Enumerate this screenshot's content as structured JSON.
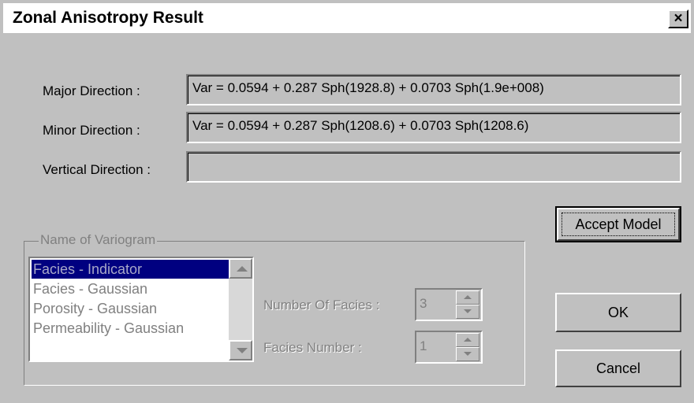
{
  "window": {
    "title": "Zonal Anisotropy Result",
    "close_symbol": "×"
  },
  "directions": [
    {
      "label": "Major Direction :",
      "value": "Var = 0.0594 + 0.287 Sph(1928.8) + 0.0703 Sph(1.9e+008)"
    },
    {
      "label": "Minor Direction :",
      "value": "Var = 0.0594 + 0.287 Sph(1208.6) + 0.0703 Sph(1208.6)"
    },
    {
      "label": "Vertical Direction :",
      "value": ""
    }
  ],
  "buttons": {
    "accept_model": "Accept Model",
    "ok": "OK",
    "cancel": "Cancel"
  },
  "variogram_group": {
    "title": "Name of Variogram",
    "items": [
      {
        "label": "Facies - Indicator",
        "selected": true
      },
      {
        "label": "Facies - Gaussian",
        "selected": false
      },
      {
        "label": "Porosity - Gaussian",
        "selected": false
      },
      {
        "label": "Permeability - Gaussian",
        "selected": false
      }
    ],
    "number_of_facies_label": "Number Of Facies :",
    "number_of_facies_value": "3",
    "facies_number_label": "Facies Number :",
    "facies_number_value": "1"
  },
  "colors": {
    "dialog_bg": "#c0c0c0",
    "selection_bg": "#000080",
    "disabled_text": "#808080"
  },
  "icons": [
    "close-icon",
    "scroll-up-icon",
    "scroll-down-icon",
    "spin-up-icon",
    "spin-down-icon"
  ]
}
